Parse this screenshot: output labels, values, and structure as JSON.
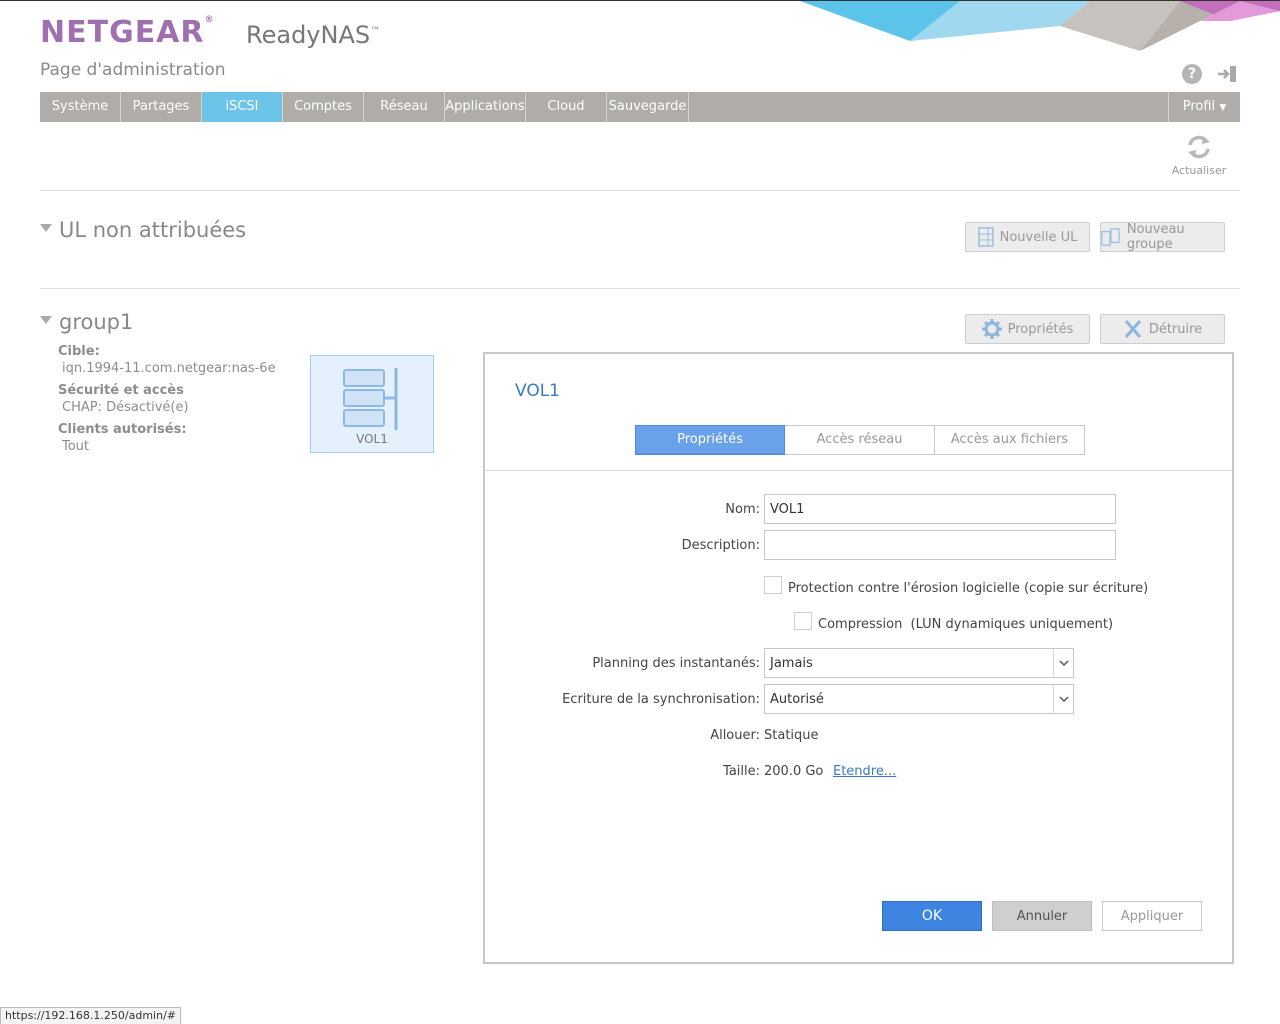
{
  "header": {
    "brand": "NETGEAR",
    "brand_mark": "®",
    "product": "ReadyNAS",
    "product_mark": "™",
    "subtitle": "Page d'administration",
    "help_icon": "question-circle-icon",
    "logout_icon": "logout-icon"
  },
  "nav": {
    "items": [
      {
        "label": "Système",
        "active": false
      },
      {
        "label": "Partages",
        "active": false
      },
      {
        "label": "iSCSI",
        "active": true
      },
      {
        "label": "Comptes",
        "active": false
      },
      {
        "label": "Réseau",
        "active": false
      },
      {
        "label": "Applications",
        "active": false
      },
      {
        "label": "Cloud",
        "active": false
      },
      {
        "label": "Sauvegarde",
        "active": false
      }
    ],
    "profile": "Profil"
  },
  "refresh": {
    "label": "Actualiser"
  },
  "unassigned": {
    "title": "UL non attribuées",
    "new_lun_button": "Nouvelle UL",
    "new_group_button": "Nouveau groupe"
  },
  "group": {
    "title": "group1",
    "properties_button": "Propriétés",
    "destroy_button": "Détruire",
    "target_label": "Cible:",
    "target_value": "iqn.1994-11.com.netgear:nas-6e",
    "security_label": "Sécurité et accès",
    "security_value": "CHAP: Désactivé(e)",
    "clients_label": "Clients autorisés:",
    "clients_value": "Tout",
    "lun_tile": "VOL1"
  },
  "dialog": {
    "title": "VOL1",
    "tabs": [
      "Propriétés",
      "Accès réseau",
      "Accès aux fichiers"
    ],
    "active_tab": 0,
    "name_label": "Nom:",
    "name_value": "VOL1",
    "description_label": "Description:",
    "description_value": "",
    "protection_label": "Protection contre l'érosion logicielle (copie sur écriture)",
    "protection_checked": false,
    "compression_label": "Compression",
    "compression_note": "(LUN dynamiques uniquement)",
    "compression_checked": false,
    "snapshot_label": "Planning des instantanés:",
    "snapshot_value": "Jamais",
    "sync_label": "Ecriture de la synchronisation:",
    "sync_value": "Autorisé",
    "allocate_label": "Allouer:",
    "allocate_value": "Statique",
    "size_label": "Taille:",
    "size_value": "200.0 Go",
    "extend_link": "Etendre...",
    "ok_button": "OK",
    "cancel_button": "Annuler",
    "apply_button": "Appliquer"
  },
  "statusbar": {
    "url": "https://192.168.1.250/admin/#"
  },
  "colors": {
    "brand": "#9f6fb0",
    "nav_bg": "#b0aca8",
    "nav_active": "#6cc4e8",
    "tab_active": "#6aa2ea",
    "ok_button": "#3d85e0",
    "link": "#3b79c0"
  }
}
